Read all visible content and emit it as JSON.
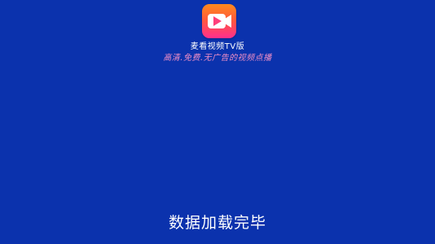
{
  "app": {
    "icon": "video-camera-app-logo",
    "name": "麦看视频TV版",
    "tagline": "高清.免费.无广告的视频点播"
  },
  "status": {
    "text": "数据加载完毕"
  },
  "colors": {
    "background": "#0b32ad",
    "tagline": "#f08ec5",
    "logo_top": "#ff8a1d",
    "logo_bottom": "#ff2f8e"
  }
}
